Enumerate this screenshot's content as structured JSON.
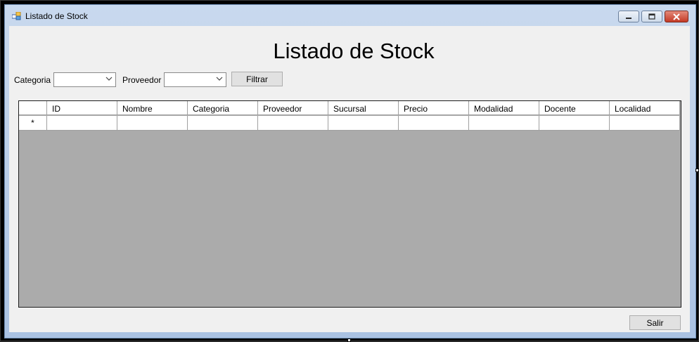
{
  "window": {
    "title": "Listado de Stock"
  },
  "form": {
    "heading": "Listado de Stock",
    "filters": {
      "categoria_label": "Categoria",
      "categoria_value": "",
      "proveedor_label": "Proveedor",
      "proveedor_value": "",
      "filter_button": "Filtrar"
    },
    "grid": {
      "columns": [
        "ID",
        "Nombre",
        "Categoria",
        "Proveedor",
        "Sucursal",
        "Precio",
        "Modalidad",
        "Docente",
        "Localidad"
      ],
      "new_row_marker": "*"
    },
    "exit_button": "Salir"
  },
  "colors": {
    "grid_background": "#ababab",
    "client_background": "#f0f0f0",
    "close_button": "#c43a26"
  }
}
